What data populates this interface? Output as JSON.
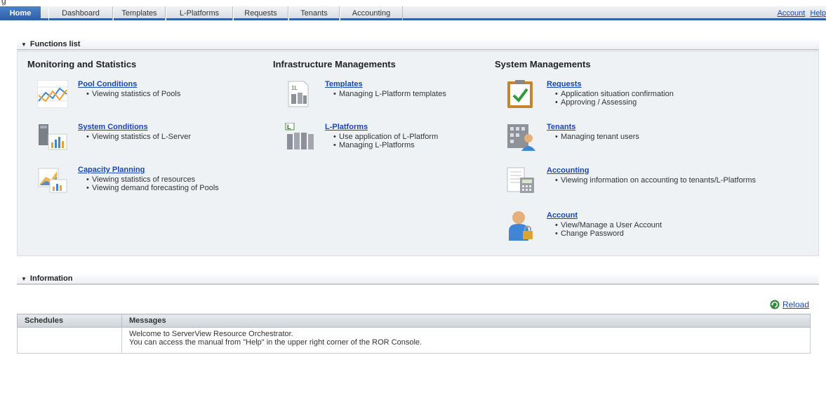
{
  "top_fragment": "g",
  "nav": {
    "tabs": [
      {
        "label": "Home",
        "active": true
      },
      {
        "label": "Dashboard"
      },
      {
        "label": "Templates"
      },
      {
        "label": "L-Platforms"
      },
      {
        "label": "Requests"
      },
      {
        "label": "Tenants"
      },
      {
        "label": "Accounting"
      }
    ],
    "account_link": "Account",
    "help_link": "Help"
  },
  "functions": {
    "header": "Functions list",
    "columns": [
      {
        "title": "Monitoring and Statistics",
        "items": [
          {
            "link": "Pool Conditions",
            "bullets": [
              "Viewing statistics of Pools"
            ],
            "icon": "chart-line-icon"
          },
          {
            "link": "System Conditions",
            "bullets": [
              "Viewing statistics of L-Server"
            ],
            "icon": "server-bar-chart-icon"
          },
          {
            "link": "Capacity Planning",
            "bullets": [
              "Viewing statistics of resources",
              "Viewing demand forecasting of Pools"
            ],
            "icon": "capacity-chart-icon"
          }
        ]
      },
      {
        "title": "Infrastructure Managements",
        "items": [
          {
            "link": "Templates",
            "bullets": [
              "Managing L-Platform templates"
            ],
            "icon": "template-document-icon"
          },
          {
            "link": "L-Platforms",
            "bullets": [
              "Use application of L-Platform",
              "Managing L-Platforms"
            ],
            "icon": "l-platform-servers-icon"
          }
        ]
      },
      {
        "title": "System Managements",
        "items": [
          {
            "link": "Requests",
            "bullets": [
              "Application situation confirmation",
              "Approving / Assessing"
            ],
            "icon": "clipboard-check-icon"
          },
          {
            "link": "Tenants",
            "bullets": [
              "Managing tenant users"
            ],
            "icon": "building-user-icon"
          },
          {
            "link": "Accounting",
            "bullets": [
              "Viewing information on accounting to tenants/L-Platforms"
            ],
            "icon": "calculator-document-icon"
          },
          {
            "link": "Account",
            "bullets": [
              "View/Manage a User Account",
              "Change Password"
            ],
            "icon": "user-lock-icon"
          }
        ]
      }
    ]
  },
  "information": {
    "header": "Information",
    "reload_label": "Reload",
    "table": {
      "headers": [
        "Schedules",
        "Messages"
      ],
      "rows": [
        {
          "schedule": "",
          "message_lines": [
            "Welcome to ServerView Resource Orchestrator.",
            "You can access the manual from \"Help\" in the upper right corner of the ROR Console."
          ]
        }
      ]
    }
  },
  "colors": {
    "nav_active": "#2f63a8",
    "link": "#1a47b8",
    "panel_bg": "#eef2f5"
  }
}
